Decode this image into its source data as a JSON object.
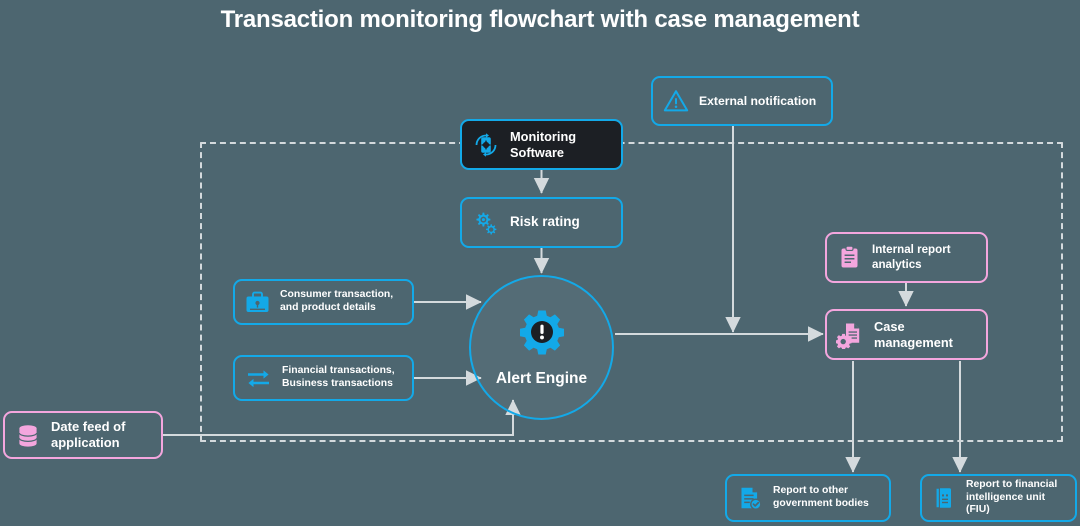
{
  "page": {
    "title": "Transaction monitoring flowchart with case management",
    "background_color": "#4d6670",
    "accent_cyan": "#13a9e8",
    "accent_pink": "#f4a6de",
    "connector_color": "#d4dadd",
    "dark_fill": "#1c1f24"
  },
  "nodes": {
    "monitoring_software": {
      "label": "Monitoring Software",
      "icon": "device-sync-icon",
      "style": "dark-cyan"
    },
    "external_notification": {
      "label": "External notification",
      "icon": "warning-triangle-icon",
      "style": "cyan"
    },
    "risk_rating": {
      "label": "Risk rating",
      "icon": "gears-icon",
      "style": "cyan"
    },
    "consumer_transaction": {
      "label": "Consumer transaction, and product details",
      "icon": "briefcase-icon",
      "style": "cyan"
    },
    "financial_transactions": {
      "label": "Financial transactions, Business transactions",
      "icon": "exchange-arrows-icon",
      "style": "cyan"
    },
    "alert_engine": {
      "label": "Alert Engine",
      "icon": "gear-alert-icon",
      "style": "circle-cyan"
    },
    "internal_report": {
      "label": "Internal report analytics",
      "icon": "clipboard-icon",
      "style": "pink"
    },
    "case_management": {
      "label": "Case management",
      "icon": "document-gear-icon",
      "style": "pink"
    },
    "date_feed": {
      "label": "Date feed of application",
      "icon": "database-icon",
      "style": "pink"
    },
    "report_government": {
      "label": "Report to other government bodies",
      "icon": "document-check-icon",
      "style": "cyan"
    },
    "report_fiu": {
      "label": "Report to financial intelligence unit (FIU)",
      "icon": "report-book-icon",
      "style": "cyan"
    }
  }
}
